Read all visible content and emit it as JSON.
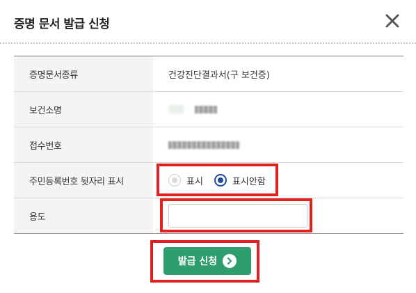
{
  "dialog": {
    "title": "증명 문서 발급 신청"
  },
  "form": {
    "rows": [
      {
        "label": "증명문서종류",
        "value": "건강진단결과서(구 보건증)"
      },
      {
        "label": "보건소명",
        "value": ""
      },
      {
        "label": "접수번호",
        "value": ""
      },
      {
        "label": "주민등록번호 뒷자리 표시",
        "value": ""
      },
      {
        "label": "용도",
        "value": ""
      }
    ],
    "ssn_display": {
      "options": [
        {
          "label": "표시",
          "selected": false
        },
        {
          "label": "표시안함",
          "selected": true
        }
      ]
    },
    "usage": {
      "value": "",
      "placeholder": ""
    }
  },
  "submit": {
    "label": "발급 신청",
    "color": "#2f9e6e"
  },
  "colors": {
    "highlight": "#e32020",
    "radio_selected": "#1e4b9c"
  }
}
